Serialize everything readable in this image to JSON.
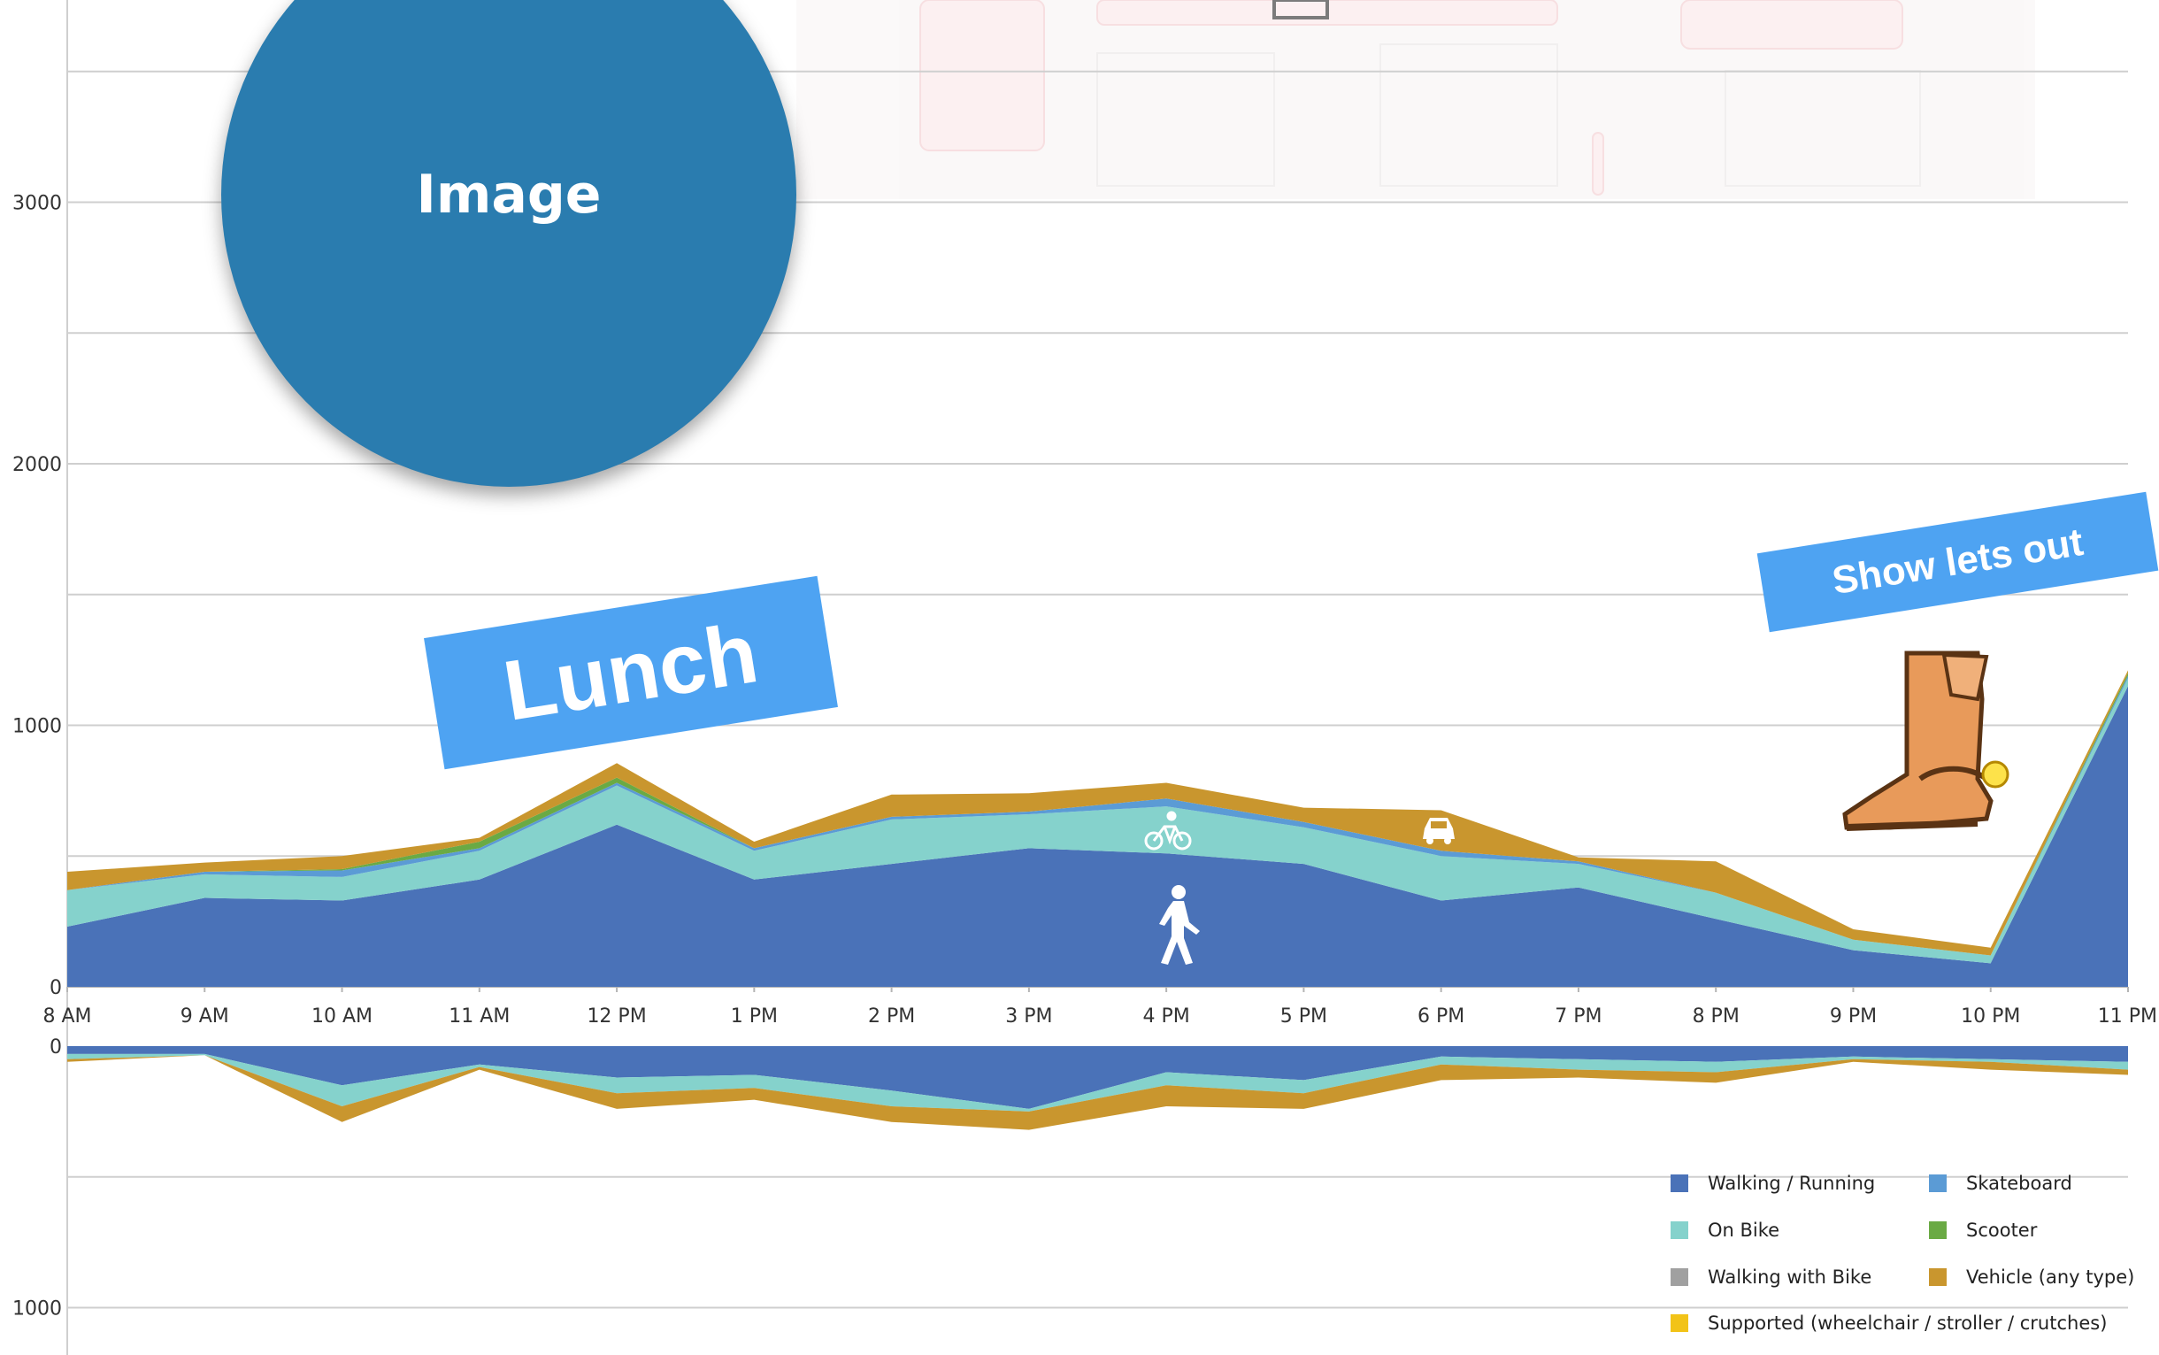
{
  "chart_data": [
    {
      "type": "area",
      "stacked": true,
      "x": [
        "8 AM",
        "9 AM",
        "10 AM",
        "11 AM",
        "12 PM",
        "1 PM",
        "2 PM",
        "3 PM",
        "4 PM",
        "5 PM",
        "6 PM",
        "7 PM",
        "8 PM",
        "9 PM",
        "10 PM",
        "11 PM"
      ],
      "ylim": [
        0,
        3600
      ],
      "yticks": [
        "0",
        "1000",
        "2000",
        "3000"
      ],
      "grid": true,
      "series": [
        {
          "name": "Walking / Running",
          "values": [
            230,
            340,
            330,
            410,
            620,
            410,
            470,
            530,
            510,
            470,
            330,
            380,
            260,
            140,
            90,
            1150
          ]
        },
        {
          "name": "On Bike",
          "values": [
            140,
            90,
            90,
            110,
            150,
            110,
            170,
            130,
            180,
            140,
            170,
            90,
            100,
            40,
            30,
            30
          ]
        },
        {
          "name": "Skateboard",
          "values": [
            0,
            10,
            25,
            10,
            10,
            10,
            10,
            10,
            30,
            20,
            20,
            10,
            0,
            0,
            0,
            10
          ]
        },
        {
          "name": "Scooter",
          "values": [
            0,
            0,
            5,
            25,
            20,
            0,
            0,
            0,
            0,
            0,
            0,
            0,
            0,
            0,
            0,
            10
          ]
        },
        {
          "name": "Walking with Bike",
          "values": [
            0,
            0,
            0,
            0,
            0,
            0,
            0,
            0,
            0,
            0,
            0,
            0,
            0,
            0,
            0,
            0
          ]
        },
        {
          "name": "Supported (wheelchair / stroller / crutches)",
          "values": [
            0,
            0,
            0,
            0,
            0,
            0,
            0,
            0,
            0,
            0,
            0,
            0,
            0,
            0,
            0,
            0
          ]
        },
        {
          "name": "Vehicle (any type)",
          "values": [
            70,
            35,
            50,
            15,
            55,
            25,
            85,
            70,
            60,
            55,
            155,
            15,
            120,
            40,
            30,
            10
          ]
        }
      ]
    },
    {
      "type": "area",
      "stacked": true,
      "inverted": true,
      "ylim": [
        0,
        1150
      ],
      "yticks": [
        "0",
        "1000"
      ],
      "grid": true,
      "series": [
        {
          "name": "Walking / Running",
          "values": [
            30,
            30,
            150,
            70,
            120,
            110,
            170,
            240,
            100,
            130,
            40,
            50,
            60,
            40,
            50,
            60
          ]
        },
        {
          "name": "On Bike",
          "values": [
            20,
            5,
            80,
            10,
            60,
            50,
            60,
            10,
            50,
            50,
            30,
            40,
            40,
            10,
            10,
            30
          ]
        },
        {
          "name": "Vehicle (any type)",
          "values": [
            10,
            0,
            60,
            10,
            60,
            45,
            60,
            70,
            80,
            60,
            60,
            30,
            40,
            10,
            30,
            20
          ]
        }
      ]
    }
  ],
  "legend": {
    "items": [
      {
        "label": "Walking / Running",
        "color": "#4a72b8"
      },
      {
        "label": "Skateboard",
        "color": "#5b9bd5"
      },
      {
        "label": "On Bike",
        "color": "#85d2cc"
      },
      {
        "label": "Scooter",
        "color": "#6aaa44"
      },
      {
        "label": "Walking with Bike",
        "color": "#a0a0a0"
      },
      {
        "label": "Vehicle (any type)",
        "color": "#c9962e"
      },
      {
        "label": "Supported (wheelchair / stroller / crutches)",
        "color": "#f2c318"
      }
    ]
  },
  "annotations": {
    "image_label": "Image",
    "lunch": "Lunch",
    "show_lets_out": "Show lets out"
  },
  "icons": [
    "walking-icon",
    "bike-icon",
    "car-icon",
    "cowboy-boot-icon"
  ]
}
